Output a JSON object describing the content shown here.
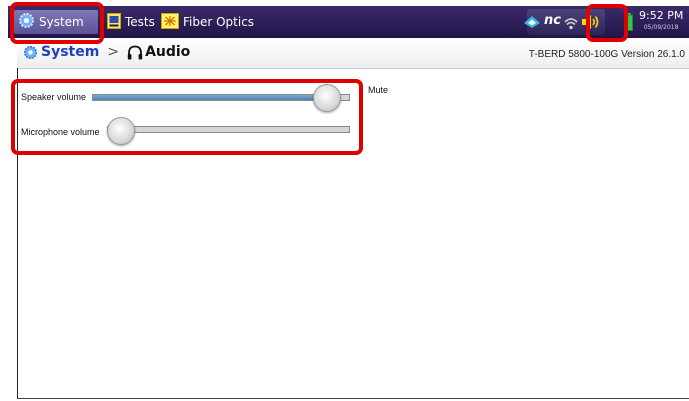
{
  "taskbar": {
    "tabs": [
      {
        "label": "System",
        "icon": "gear-icon",
        "active": true
      },
      {
        "label": "Tests",
        "icon": "tests-icon"
      },
      {
        "label": "Fiber Optics",
        "icon": "fiber-optics-icon"
      }
    ],
    "status_icons": [
      "network-icon",
      "nc-icon",
      "wifi-icon",
      "speaker-icon",
      "battery-icon"
    ],
    "nc_text": "nc",
    "clock": {
      "time": "9:52 PM",
      "date": "05/09/2018"
    }
  },
  "header": {
    "breadcrumb_root": "System",
    "separator": ">",
    "page_title": "Audio",
    "version": "T-BERD 5800-100G Version 26.1.0"
  },
  "audio": {
    "speaker_label": "Speaker volume",
    "speaker_level": 0.96,
    "mute_label": "Mute",
    "microphone_label": "Microphone volume",
    "microphone_level": 0.0
  },
  "colors": {
    "taskbar": "#2b1f5a",
    "breadcrumb": "#1f3fbf",
    "highlight": "#e00000",
    "slider_fill": "#5f8ec2"
  }
}
